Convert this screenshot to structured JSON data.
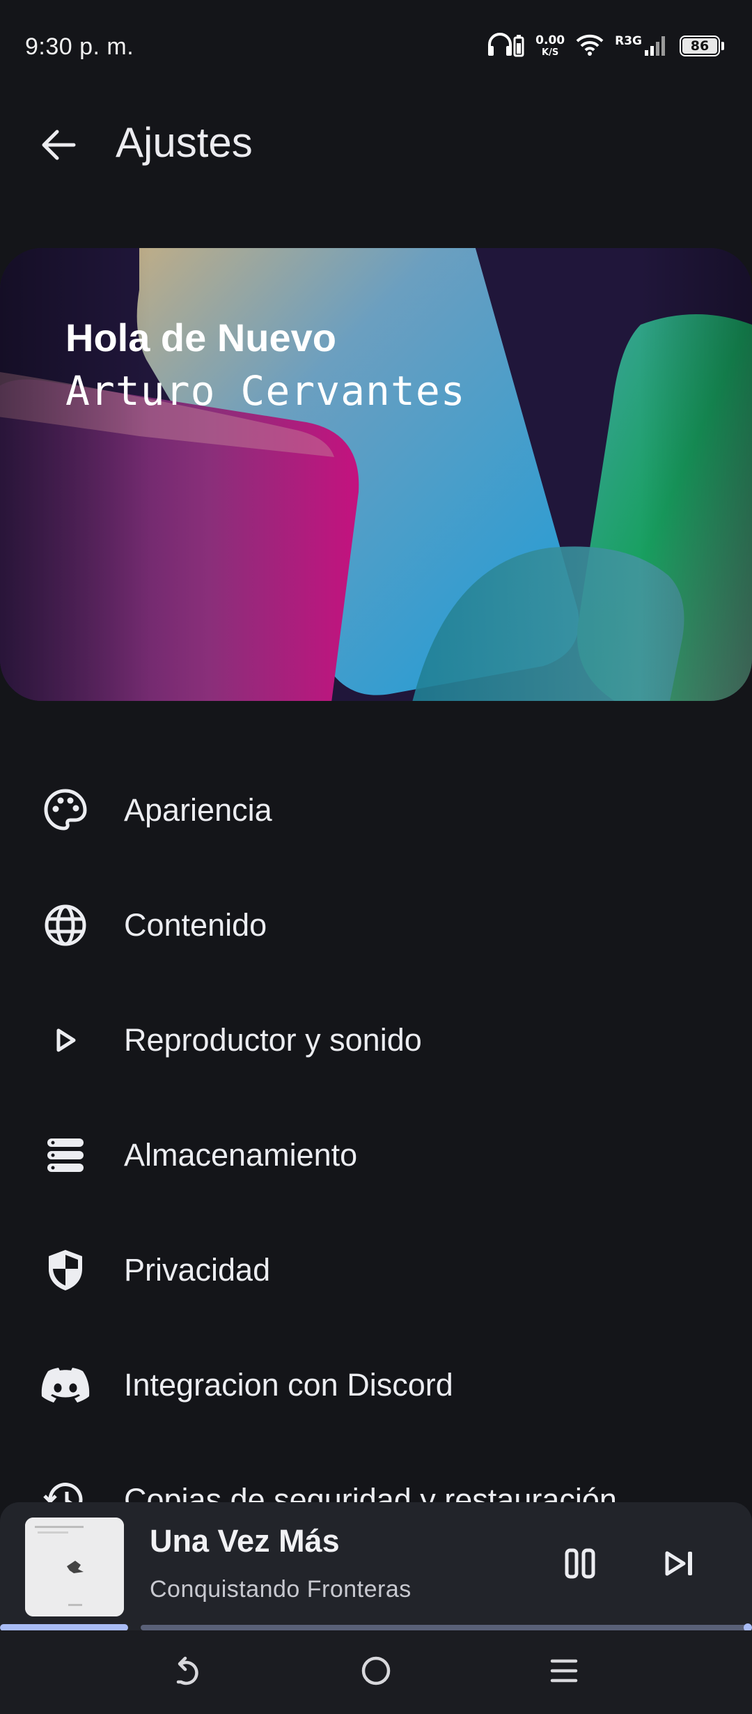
{
  "status_bar": {
    "time": "9:30 p. m.",
    "net_speed_value": "0.00",
    "net_speed_unit": "K/S",
    "network_type": "R3G",
    "battery_level": "86",
    "icons": [
      "headphones-battery-icon",
      "wifi-icon",
      "signal-icon",
      "battery-icon"
    ]
  },
  "app_bar": {
    "back_icon": "arrow-back-icon",
    "title": "Ajustes"
  },
  "hero": {
    "greeting": "Hola de Nuevo",
    "user_name": "Arturo Cervantes"
  },
  "settings": {
    "items": [
      {
        "label": "Apariencia",
        "icon": "palette-icon"
      },
      {
        "label": "Contenido",
        "icon": "globe-icon"
      },
      {
        "label": "Reproductor y sonido",
        "icon": "play-icon"
      },
      {
        "label": "Almacenamiento",
        "icon": "storage-icon"
      },
      {
        "label": "Privacidad",
        "icon": "shield-icon"
      },
      {
        "label": "Integracion con Discord",
        "icon": "discord-icon"
      },
      {
        "label": "Copias de seguridad y restauración",
        "icon": "restore-icon"
      }
    ]
  },
  "player": {
    "track_title": "Una Vez Más",
    "artist": "Conquistando Fronteras",
    "state": "playing",
    "progress_fraction": 0.17,
    "colors": {
      "progress": "#a9bcf5",
      "track": "#5a6178"
    }
  },
  "nav_bar": {
    "icons": [
      "back-nav-icon",
      "home-nav-icon",
      "menu-nav-icon"
    ]
  }
}
